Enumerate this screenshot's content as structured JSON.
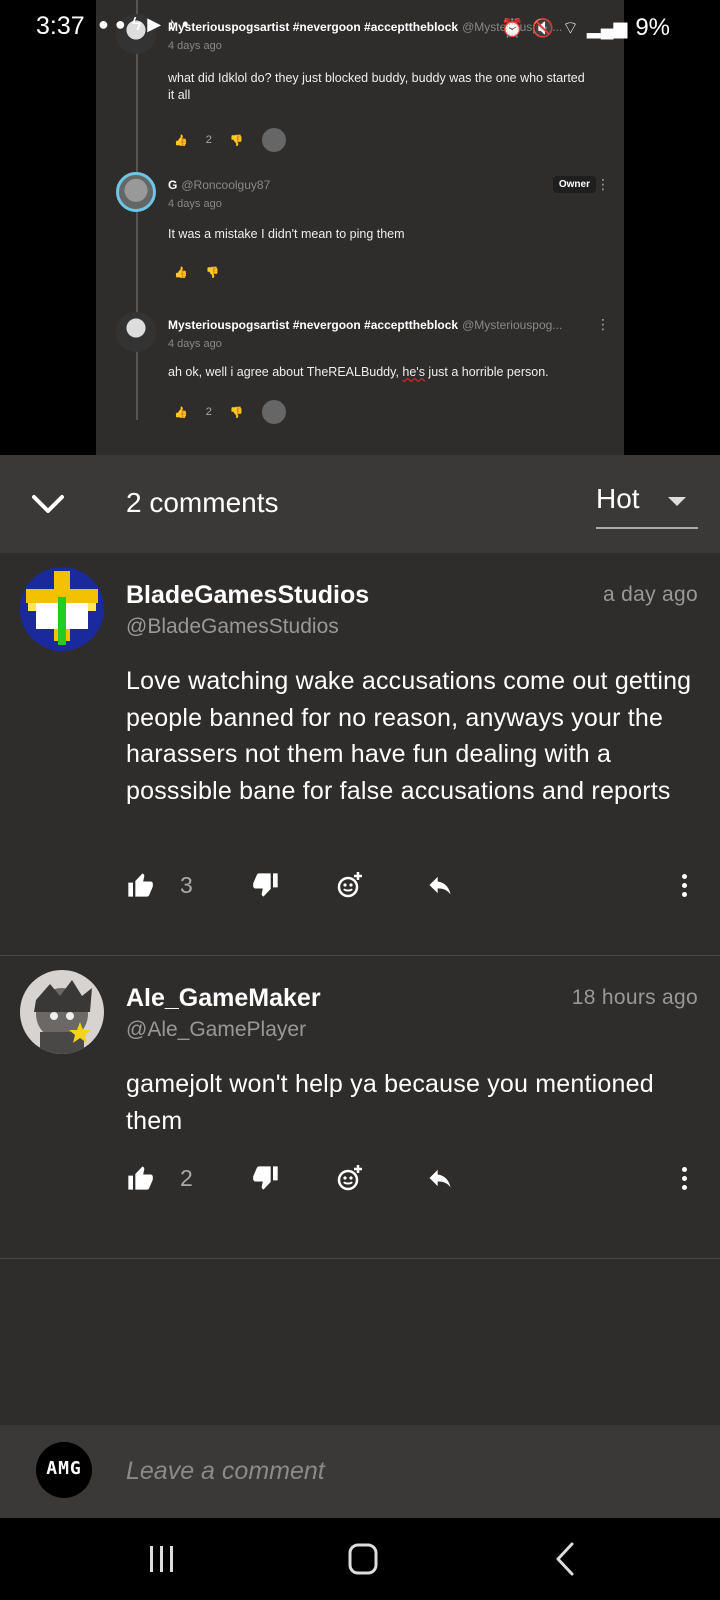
{
  "status_bar": {
    "time": "3:37",
    "battery": "9%"
  },
  "background_thread": {
    "comments": [
      {
        "name": "Mysteriouspogsartist #nevergoon #accepttheblock",
        "handle": "@Mysteriouspog...",
        "time": "4 days ago",
        "text": "what did Idklol do? they just blocked buddy, buddy was the one who started it all",
        "likes": "2"
      },
      {
        "name": "G",
        "handle": "@Roncoolguy87",
        "badge": "Owner",
        "time": "4 days ago",
        "text": "It was a mistake I didn't mean to ping them",
        "likes": ""
      },
      {
        "name": "Mysteriouspogsartist #nevergoon #accepttheblock",
        "handle": "@Mysteriouspog...",
        "time": "4 days ago",
        "text_before": "ah ok, well i agree about TheREALBuddy, ",
        "text_underlined": "he's",
        "text_after": " just a horrible person.",
        "likes": "2"
      }
    ]
  },
  "header": {
    "comment_count": "2 comments",
    "sort": {
      "selected": "Hot"
    }
  },
  "comments": [
    {
      "name": "BladeGamesStudios",
      "handle": "@BladeGamesStudios",
      "time": "a day ago",
      "text": "Love watching wake accusations come out getting people banned for no reason, anyways your the harassers not them have fun dealing with a posssible bane for false accusations and reports",
      "likes": "3"
    },
    {
      "name": "Ale_GameMaker",
      "handle": "@Ale_GamePlayer",
      "time": "18 hours ago",
      "text": "gamejolt won't help ya because you mentioned them",
      "likes": "2"
    }
  ],
  "compose": {
    "placeholder": "Leave a comment",
    "avatar_text": "AMG"
  },
  "icons": {
    "collapse": "chevron-down-icon",
    "like": "thumbs-up-icon",
    "dislike": "thumbs-down-icon",
    "react": "emoji-add-icon",
    "reply": "reply-icon",
    "more": "more-vertical-icon"
  },
  "colors": {
    "sheet_bg": "#2f2d2c",
    "header_bg": "#3b3937",
    "muted_text": "#9a9896",
    "owner_ring": "#6ec6e6"
  }
}
